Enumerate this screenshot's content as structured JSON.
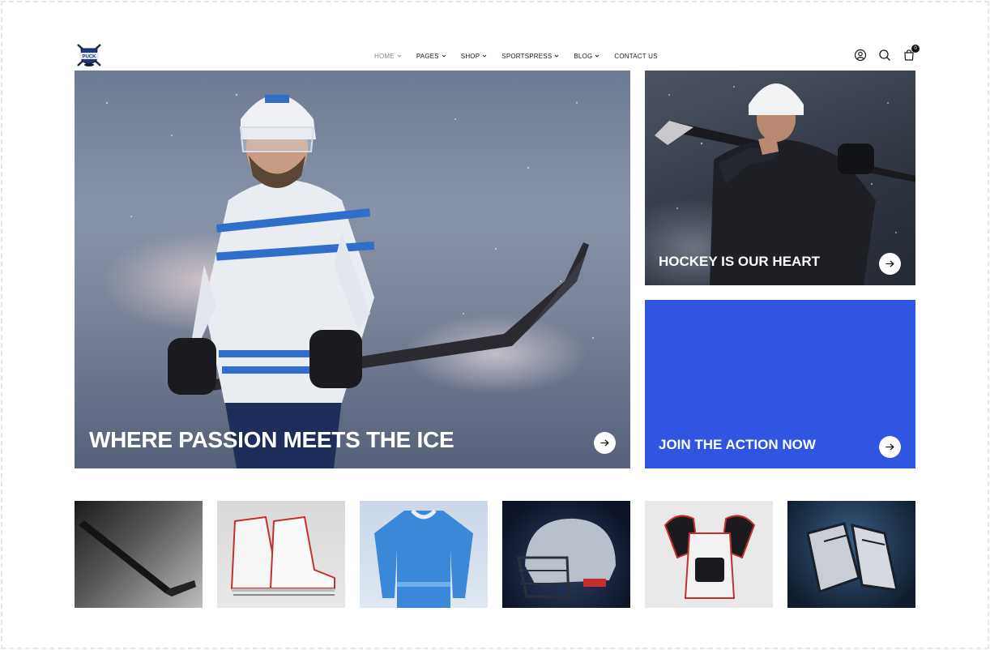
{
  "brand": {
    "logo_text": "PUCK"
  },
  "nav": {
    "items": [
      {
        "label": "HOME",
        "active": true,
        "dropdown": true
      },
      {
        "label": "PAGES",
        "active": false,
        "dropdown": true
      },
      {
        "label": "SHOP",
        "active": false,
        "dropdown": true
      },
      {
        "label": "SPORTSPRESS",
        "active": false,
        "dropdown": true
      },
      {
        "label": "BLOG",
        "active": false,
        "dropdown": true
      },
      {
        "label": "CONTACT US",
        "active": false,
        "dropdown": false
      }
    ]
  },
  "header_icons": {
    "account": "user-circle-icon",
    "search": "search-icon",
    "cart": "shopping-bag-icon",
    "cart_count": "0"
  },
  "hero": {
    "title": "WHERE PASSION MEETS THE ICE",
    "arrow_icon": "arrow-right-icon"
  },
  "promo_top": {
    "title": "HOCKEY IS OUR HEART",
    "arrow_icon": "arrow-right-icon"
  },
  "promo_bottom": {
    "title": "JOIN THE ACTION NOW",
    "arrow_icon": "arrow-right-icon",
    "background": "#3055e0"
  },
  "products": [
    {
      "image": "hockey-stick-image"
    },
    {
      "image": "hockey-skates-image"
    },
    {
      "image": "hockey-jersey-image"
    },
    {
      "image": "hockey-helmet-image"
    },
    {
      "image": "shoulder-pads-image"
    },
    {
      "image": "hockey-gloves-image"
    }
  ],
  "colors": {
    "accent_blue": "#3055e0",
    "text_dark": "#1a1a1a",
    "nav_active": "#8a8a8a"
  }
}
